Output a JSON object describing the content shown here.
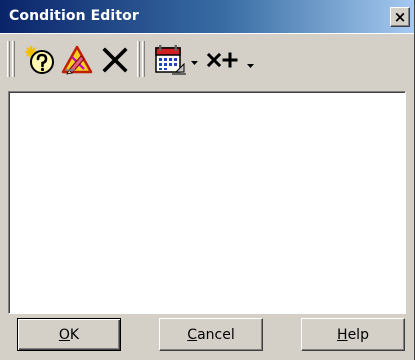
{
  "window": {
    "title": "Condition Editor",
    "close_glyph": "×"
  },
  "toolbar": {
    "items": [
      {
        "name": "condition-help-icon",
        "kind": "button"
      },
      {
        "name": "clear-condition-icon",
        "kind": "button"
      },
      {
        "name": "delete-icon",
        "kind": "button"
      },
      {
        "name": "calendar-icon",
        "kind": "dropdown-button"
      },
      {
        "name": "operator-icon",
        "kind": "dropdown-button",
        "label": "x+"
      }
    ]
  },
  "buttons": {
    "ok": {
      "prefix": "",
      "underlined": "O",
      "suffix": "K"
    },
    "cancel": {
      "prefix": "",
      "underlined": "C",
      "suffix": "ancel"
    },
    "help": {
      "prefix": "",
      "underlined": "H",
      "suffix": "elp"
    }
  },
  "colors": {
    "titlebar_start": "#0a246a",
    "titlebar_end": "#a6caf0",
    "face": "#d4d0c8"
  }
}
